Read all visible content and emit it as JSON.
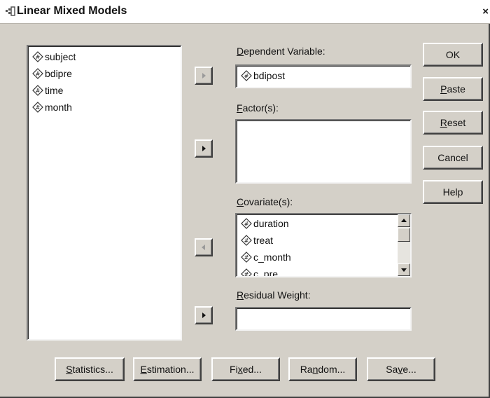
{
  "window": {
    "title": "Linear Mixed Models",
    "close_glyph": "×"
  },
  "source_list": {
    "items": [
      {
        "label": "subject"
      },
      {
        "label": "bdipre"
      },
      {
        "label": "time"
      },
      {
        "label": "month"
      }
    ]
  },
  "dependent": {
    "label_key": "D",
    "label_rest": "ependent Variable:",
    "value": "bdipost"
  },
  "factors": {
    "label_key": "F",
    "label_rest": "actor(s):"
  },
  "covariates": {
    "label_key": "C",
    "label_rest": "ovariate(s):",
    "items": [
      {
        "label": "duration"
      },
      {
        "label": "treat"
      },
      {
        "label": "c_month"
      },
      {
        "label": "c_pre"
      }
    ]
  },
  "residual_weight": {
    "label_key": "R",
    "label_rest": "esidual Weight:"
  },
  "right_buttons": {
    "ok": "OK",
    "paste_key": "P",
    "paste_rest": "aste",
    "reset_key": "R",
    "reset_rest": "eset",
    "cancel": "Cancel",
    "help": "Help"
  },
  "bottom_buttons": {
    "statistics_key": "S",
    "statistics_rest": "tatistics...",
    "estimation_key": "E",
    "estimation_rest": "stimation...",
    "fixed_pre": "Fi",
    "fixed_key": "x",
    "fixed_rest": "ed...",
    "random_pre": "Ra",
    "random_key": "n",
    "random_rest": "dom...",
    "save_pre": "Sa",
    "save_key": "v",
    "save_rest": "e..."
  }
}
